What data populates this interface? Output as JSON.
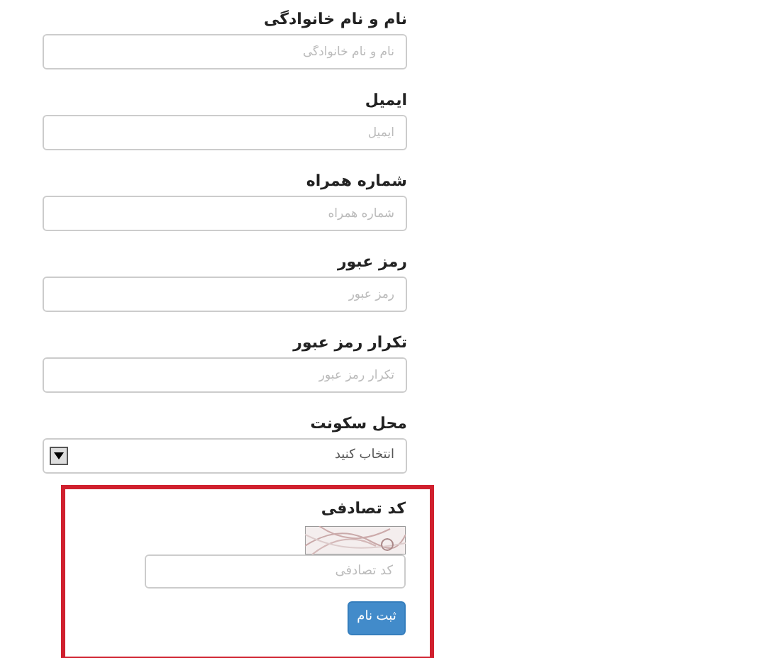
{
  "fields": [
    {
      "kind": "text",
      "label": "نام و نام خانوادگی",
      "placeholder": "نام و نام خانوادگی"
    },
    {
      "kind": "text",
      "label": "ایمیل",
      "placeholder": "ایمیل"
    },
    {
      "kind": "text",
      "label": "شماره همراه",
      "placeholder": "شماره همراه"
    },
    {
      "kind": "text",
      "label": "رمز عبور",
      "placeholder": "رمز عبور"
    },
    {
      "kind": "text",
      "label": "تکرار رمز عبور",
      "placeholder": "تکرار رمز عبور"
    },
    {
      "kind": "select",
      "label": "محل سکونت",
      "value": "انتخاب کنید"
    }
  ],
  "captcha": {
    "label": "کد تصادفی",
    "placeholder": "کد تصادفی"
  },
  "submit_button": "ثبت نام"
}
